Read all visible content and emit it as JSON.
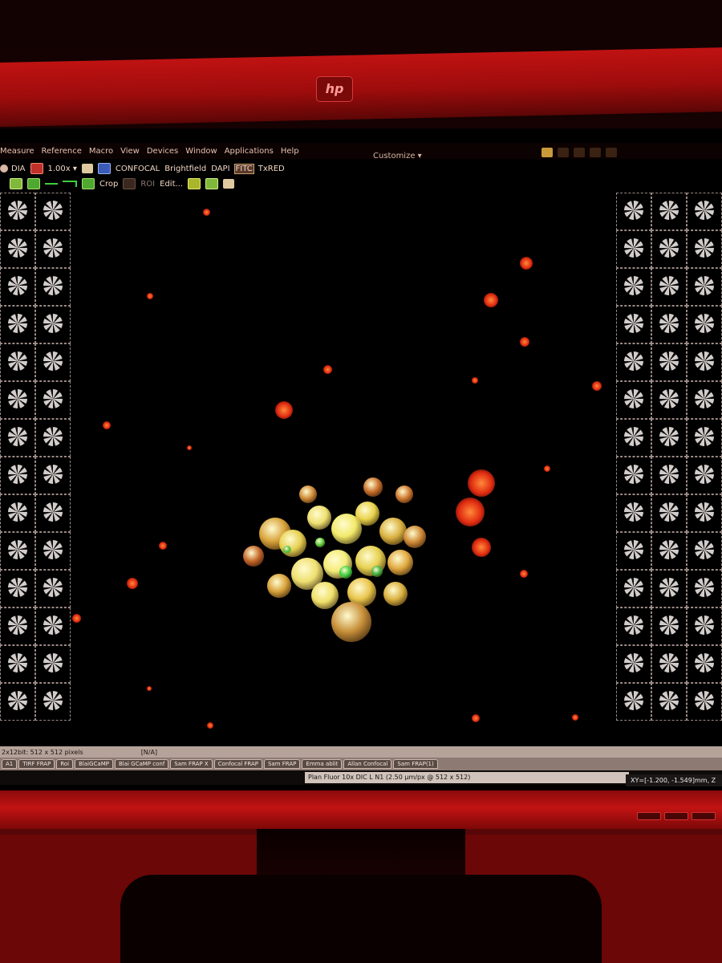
{
  "menubar": {
    "items": [
      "Measure",
      "Reference",
      "Macro",
      "View",
      "Devices",
      "Window",
      "Applications",
      "Help"
    ],
    "customize": "Customize ▾"
  },
  "toolbar": {
    "dia": "DIA",
    "zoom": "1.00x ▾",
    "channels": [
      "CONFOCAL",
      "Brightfield",
      "DAPI",
      "FITC",
      "TxRED"
    ],
    "crop": "Crop",
    "roi": "ROI",
    "edit": "Edit..."
  },
  "status": {
    "image_info": "2x12bit: 512 x 512 pixels",
    "na": "[N/A]"
  },
  "tabs": [
    "A1",
    "TIRF FRAP",
    "Roi",
    "BlaiGCaMP",
    "Blai GCaMP conf",
    "Sam FRAP X",
    "Confocal FRAP",
    "Sam FRAP",
    "Emma ablit",
    "Allan Confocal",
    "Sam FRAP(1)"
  ],
  "objective": "Plan Fluor 10x DIC L N1 (2.50 µm/px @ 512 x 512)",
  "coordinates": "XY=[-1.200, -1.549]mm, Z",
  "logo": "hp",
  "colors": {
    "bezel": "#c01212",
    "cell_signal": "#e8d24a",
    "red_channel": "#ff3a1a",
    "green_channel": "#3fcf3f"
  }
}
